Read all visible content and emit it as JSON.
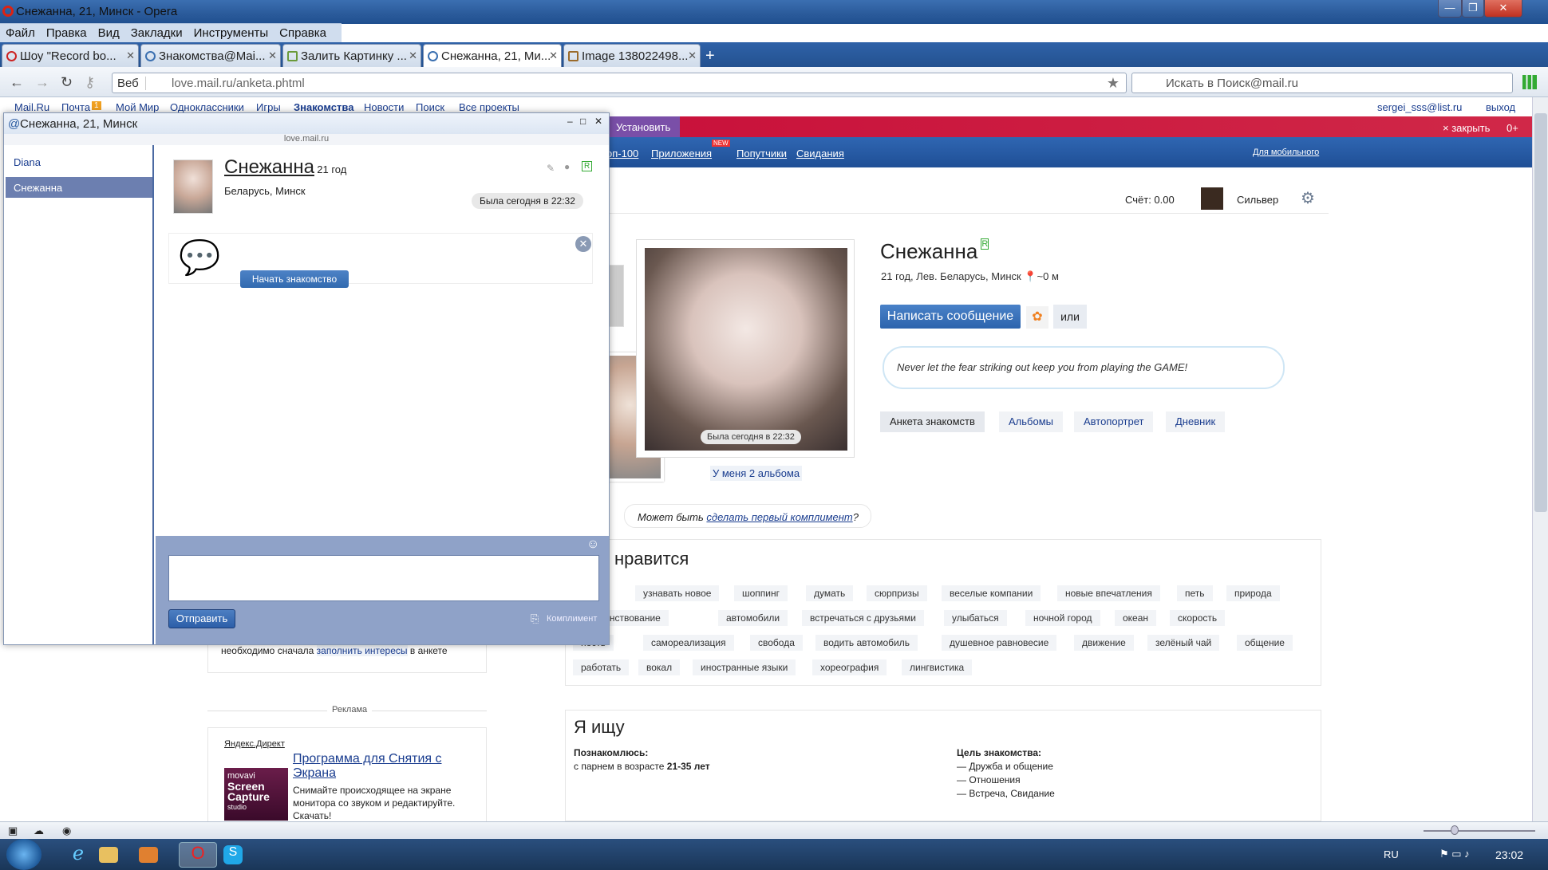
{
  "window": {
    "title": "Снежанна, 21, Минск - Opera",
    "min": "—",
    "max": "❐",
    "close": "✕"
  },
  "menu": [
    "Файл",
    "Правка",
    "Вид",
    "Закладки",
    "Инструменты",
    "Справка"
  ],
  "tabs": [
    {
      "label": "Шоу \"Record bo..."
    },
    {
      "label": "Знакомства@Mai..."
    },
    {
      "label": "Залить Картинку ..."
    },
    {
      "label": "Снежанна, 21, Ми..."
    },
    {
      "label": "Image 138022498..."
    }
  ],
  "address": {
    "web": "Веб",
    "url": "love.mail.ru/anketa.phtml",
    "search_placeholder": "Искать в Поиск@mail.ru"
  },
  "portal": {
    "items": [
      "Mail.Ru",
      "Почта",
      "Мой Мир",
      "Одноклассники",
      "Игры",
      "Знакомства",
      "Новости",
      "Поиск",
      "Все проекты"
    ],
    "mail_badge": "1",
    "user": "sergei_sss@list.ru",
    "logout": "выход"
  },
  "banner": {
    "install": "Установить",
    "close": "× закрыть",
    "age": "0+"
  },
  "bluenav": {
    "items": [
      "оп-100",
      "Приложения",
      "Попутчики",
      "Свидания"
    ],
    "new_badge": "NEW",
    "mobile": "Для мобильного"
  },
  "account": {
    "score": "Счёт: 0.00",
    "status": "Сильвер"
  },
  "profile": {
    "name": "Снежанна",
    "info": "21 год, Лев. Беларусь, Минск",
    "distance": "~0 м",
    "message_button": "Написать сообщение",
    "or": "или",
    "quote": "Never let the fear striking out keep you from playing the GAME!",
    "tabs": [
      "Анкета знакомств",
      "Альбомы",
      "Автопортрет",
      "Дневник"
    ],
    "photo_status": "Была сегодня в 22:32",
    "albums_link": "У меня 2 альбома",
    "compliment_pre": "Может быть",
    "compliment_link": "сделать первый комплимент",
    "compliment_post": "?"
  },
  "likes": {
    "title": "нравится",
    "tags": [
      "а",
      "узнавать новое",
      "шоппинг",
      "думать",
      "сюрпризы",
      "веселые компании",
      "новые впечатления",
      "петь",
      "природа",
      "вершенствование",
      "автомобили",
      "встречаться с друзьями",
      "улыбаться",
      "ночной город",
      "океан",
      "скорость",
      "ность",
      "самореализация",
      "свобода",
      "водить автомобиль",
      "душевное равновесие",
      "движение",
      "зелёный чай",
      "общение",
      "работать",
      "вокал",
      "иностранные языки",
      "хореография",
      "лингвистика"
    ]
  },
  "seeking": {
    "title": "Я ищу",
    "meet_label": "Познакомлюсь:",
    "meet_value_pre": "с парнем в возрасте",
    "meet_value_age": "21-35 лет",
    "goal_label": "Цель знакомства:",
    "goals": [
      "— Дружба и общение",
      "— Отношения",
      "— Встреча, Свидание"
    ]
  },
  "sidebar": {
    "interests_pre": "необходимо сначала",
    "interests_link": "заполнить интересы",
    "interests_post": "в анкете",
    "ads_label": "Реклама",
    "direct": "Яндекс.Директ",
    "ad_title": "Программа для Снятия с Экрана",
    "ad_text": "Снимайте происходящее на экране монитора со звуком и редактируйте. Скачать!",
    "ad_logo": [
      "movavi",
      "Screen",
      "Capture",
      "studio"
    ]
  },
  "chat": {
    "title": "Снежанна, 21, Минск",
    "host": "love.mail.ru",
    "contacts": [
      "Diana",
      "Снежанна"
    ],
    "name": "Снежанна",
    "age": "21 год",
    "location": "Беларусь, Минск",
    "last_seen": "Была сегодня в 22:32",
    "start_button": "Начать знакомство",
    "send_button": "Отправить",
    "compliment": "Комплимент"
  },
  "taskbar": {
    "lang": "RU",
    "time": "23:02"
  }
}
